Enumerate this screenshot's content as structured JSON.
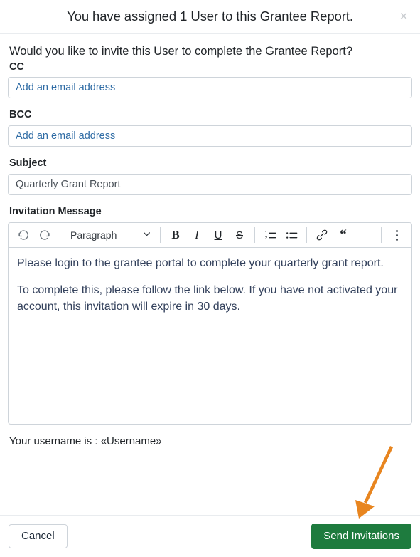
{
  "header": {
    "title": "You have assigned 1 User to this Grantee Report.",
    "close_label": "×",
    "close_icon": "close-icon"
  },
  "body": {
    "intro": "Would you like to invite this User to complete the Grantee Report?",
    "fields": {
      "cc": {
        "label": "CC",
        "value": "",
        "placeholder": "Add an email address"
      },
      "bcc": {
        "label": "BCC",
        "value": "",
        "placeholder": "Add an email address"
      },
      "subject": {
        "label": "Subject",
        "value": "Quarterly Grant Report",
        "placeholder": ""
      },
      "message": {
        "label": "Invitation Message"
      }
    },
    "editor": {
      "toolbar": {
        "undo": "undo-icon",
        "redo": "redo-icon",
        "block_format": "Paragraph",
        "chevron": "chevron-down-icon",
        "bold": "B",
        "italic": "I",
        "underline": "U",
        "strikethrough": "S",
        "ordered_list": "numbered-list-icon",
        "bullet_list": "bullet-list-icon",
        "link": "link-icon",
        "blockquote": "“",
        "more": "kebab-menu-icon"
      },
      "paragraphs": [
        "Please login to the grantee portal to complete your quarterly grant report.",
        "To complete this, please follow the link below. If you have not activated your account, this invitation will expire in 30 days."
      ]
    },
    "username_line": "Your username is : «Username»"
  },
  "footer": {
    "cancel_label": "Cancel",
    "send_label": "Send Invitations"
  },
  "colors": {
    "accent_green": "#1e7b3e",
    "placeholder_blue": "#2f6ca5",
    "annotation_orange": "#e8851f",
    "body_text": "#33415c",
    "border": "#ced4da"
  },
  "annotation": {
    "arrow": "orange-annotation-arrow",
    "points_to": "Send Invitations"
  }
}
